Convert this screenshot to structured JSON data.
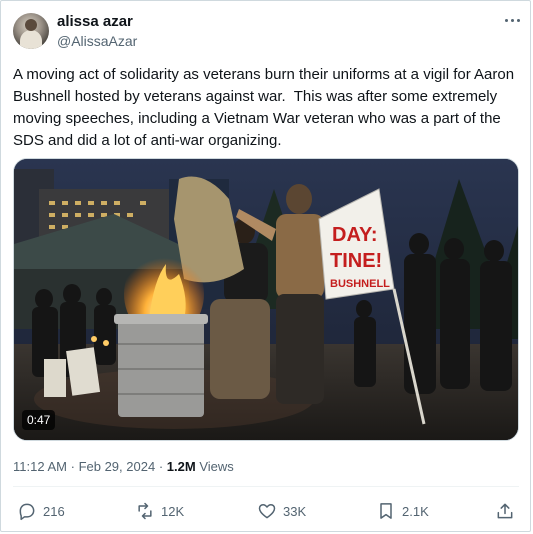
{
  "author": {
    "name": "alissa azar",
    "handle": "@AlissaAzar"
  },
  "tweet": {
    "text": "A moving act of solidarity as veterans burn their uniforms at a vigil for Aaron Bushnell hosted by veterans against war.  This was after some extremely moving speeches, including a Vietnam War veteran who was a part of the SDS and did a lot of anti-war organizing."
  },
  "media": {
    "duration": "0:47",
    "sign_lines": [
      "DAY:",
      "TINE!",
      "BUSHNELL"
    ]
  },
  "meta": {
    "time": "11:12 AM",
    "separator": "·",
    "date": "Feb 29, 2024",
    "views_count": "1.2M",
    "views_label": "Views"
  },
  "actions": {
    "replies": "216",
    "reposts": "12K",
    "likes": "33K",
    "bookmarks": "2.1K"
  },
  "icons": [
    "more-icon",
    "reply-icon",
    "repost-icon",
    "like-icon",
    "bookmark-icon",
    "share-icon"
  ],
  "colors": {
    "text": "#0f1419",
    "secondary": "#536471",
    "border": "#cfd9de"
  }
}
